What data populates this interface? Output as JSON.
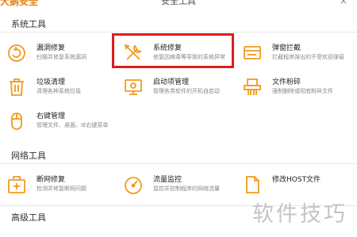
{
  "titlebar": {
    "app_name": "大鹅安全",
    "title": "安全工具",
    "close_glyph": "×"
  },
  "sections": {
    "system": {
      "title": "系统工具",
      "tools": [
        {
          "name": "漏洞修复",
          "desc": "扫描并修复系统漏洞",
          "icon": "shield-repair-icon"
        },
        {
          "name": "系统修复",
          "desc": "修复因病毒等导致的系统异常",
          "icon": "wrench-screwdriver-icon"
        },
        {
          "name": "弹窗拦截",
          "desc": "拦截程序弹出的不受欢迎弹窗",
          "icon": "popup-window-icon"
        },
        {
          "name": "垃圾清理",
          "desc": "清理各种系统垃圾",
          "icon": "trash-icon"
        },
        {
          "name": "启动项管理",
          "desc": "管理各类软件的开机自启动",
          "icon": "startup-monitor-icon"
        },
        {
          "name": "文件粉碎",
          "desc": "强制删除或彻底粉碎文件",
          "icon": "shredder-icon"
        },
        {
          "name": "右键管理",
          "desc": "管理文件、桌面、IE右键菜单",
          "icon": "mouse-icon"
        }
      ]
    },
    "network": {
      "title": "网络工具",
      "tools": [
        {
          "name": "断网修复",
          "desc": "检测并修复断网问题",
          "icon": "network-repair-icon"
        },
        {
          "name": "流量监控",
          "desc": "监控并控制程序的网络流量",
          "icon": "speedometer-icon"
        },
        {
          "name": "修改HOST文件",
          "desc": "",
          "icon": "host-file-icon"
        }
      ]
    },
    "advanced": {
      "title": "高级工具"
    }
  },
  "watermark": "软件技巧",
  "colors": {
    "accent": "#f29a1e",
    "highlight": "#e11b1b"
  }
}
